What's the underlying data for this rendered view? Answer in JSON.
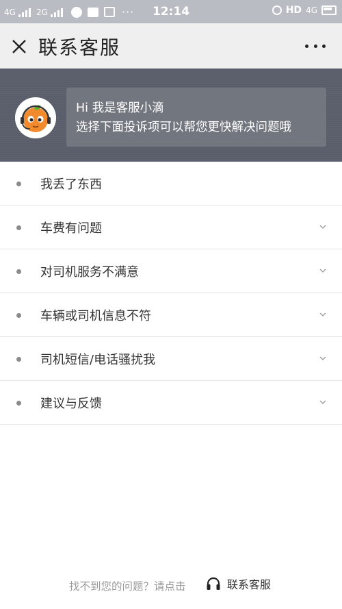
{
  "status_bar": {
    "network1": "4G",
    "network2": "2G",
    "dots": "···",
    "time": "12:14",
    "hd": "HD",
    "network3": "4G"
  },
  "nav": {
    "title": "联系客服"
  },
  "banner": {
    "greeting": "Hi 我是客服小滴",
    "subtitle": "选择下面投诉项可以帮您更快解决问题哦"
  },
  "menu": {
    "items": [
      {
        "label": "我丢了东西",
        "has_chevron": false
      },
      {
        "label": "车费有问题",
        "has_chevron": true
      },
      {
        "label": "对司机服务不满意",
        "has_chevron": true
      },
      {
        "label": "车辆或司机信息不符",
        "has_chevron": true
      },
      {
        "label": "司机短信/电话骚扰我",
        "has_chevron": true
      },
      {
        "label": "建议与反馈",
        "has_chevron": true
      }
    ]
  },
  "footer": {
    "prompt": "找不到您的问题？请点击",
    "link_label": "联系客服"
  },
  "colors": {
    "status_bar_bg": "#b9bcc2",
    "nav_bg": "#efefef",
    "banner_bg": "#5a5e6b",
    "bubble_bg": "#72767f"
  }
}
